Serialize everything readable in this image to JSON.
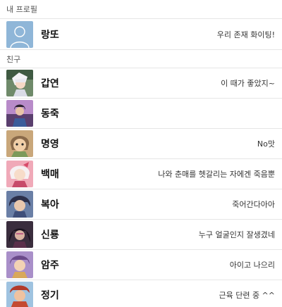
{
  "my_profile": {
    "section_label": "내 프로필",
    "name": "랑또",
    "status": "우리 존재 화이팅!"
  },
  "friends": {
    "section_label": "친구",
    "items": [
      {
        "name": "갑연",
        "status": "이 때가 좋았지~"
      },
      {
        "name": "동죽",
        "status": ""
      },
      {
        "name": "명영",
        "status": "No맛"
      },
      {
        "name": "백매",
        "status": "나와 춘매를 헷갈리는 자에겐 죽음뿐"
      },
      {
        "name": "복아",
        "status": "죽어간다아아"
      },
      {
        "name": "신룡",
        "status": "누구 얼굴인지 잘생겼네"
      },
      {
        "name": "암주",
        "status": "아이고 나으리"
      },
      {
        "name": "정기",
        "status": "근육 단련 중 ^^"
      }
    ]
  },
  "colors": {
    "divider": "#e6e6e6",
    "default_avatar_bg": "#8fb6d8",
    "section_text": "#555555"
  }
}
